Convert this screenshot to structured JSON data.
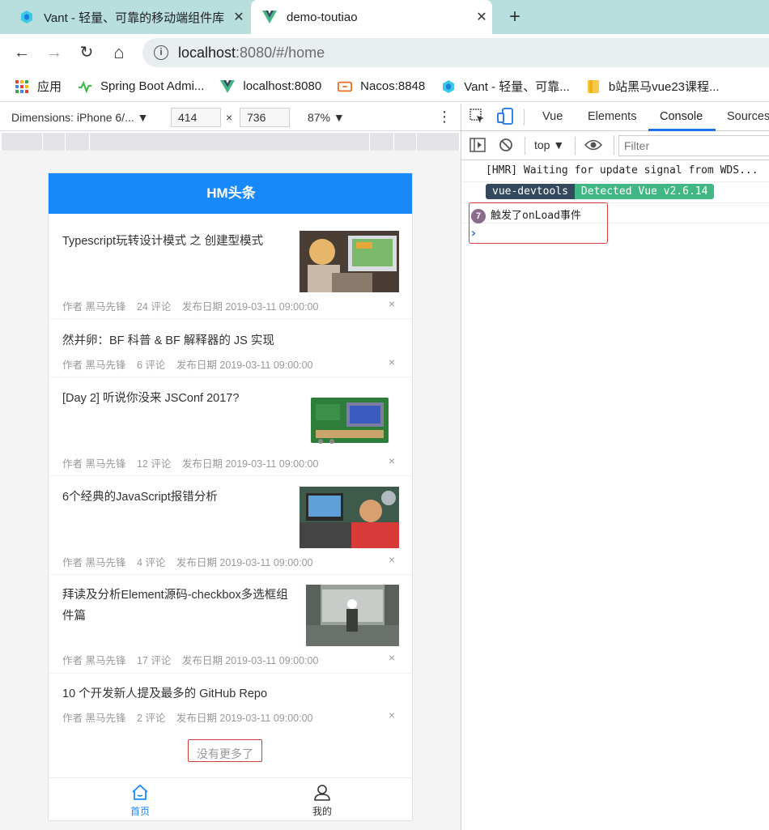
{
  "browser": {
    "tabs": [
      {
        "title": "Vant - 轻量、可靠的移动端组件库",
        "close": "✕",
        "active": false
      },
      {
        "title": "demo-toutiao",
        "close": "✕",
        "active": true
      }
    ],
    "new_tab": "+",
    "nav": {
      "back": "←",
      "forward": "→",
      "reload": "↻",
      "home": "⌂"
    },
    "url_host": "localhost",
    "url_rest": ":8080/#/home",
    "bookmarks": [
      {
        "label": "应用",
        "icon": "apps-grid-icon"
      },
      {
        "label": "Spring Boot Admi...",
        "icon": "spring-boot-icon"
      },
      {
        "label": "localhost:8080",
        "icon": "vue-icon"
      },
      {
        "label": "Nacos:8848",
        "icon": "nacos-icon"
      },
      {
        "label": "Vant - 轻量、可靠...",
        "icon": "vant-icon"
      },
      {
        "label": "b站黑马vue23课程...",
        "icon": "folder-icon"
      }
    ]
  },
  "device_toolbar": {
    "dimensions_label": "Dimensions: iPhone 6/... ▼",
    "width": "414",
    "times": "×",
    "height": "736",
    "zoom": "87% ▼",
    "more": "⋮"
  },
  "app": {
    "navbar_title": "HM头条",
    "articles": [
      {
        "title": "Typescript玩转设计模式 之 创建型模式",
        "author": "作者 黑马先锋",
        "comments": "24 评论",
        "date": "发布日期 2019-03-11 09:00:00",
        "has_image": true
      },
      {
        "title": "然并卵：BF 科普 & BF 解释器的 JS 实现",
        "author": "作者 黑马先锋",
        "comments": "6 评论",
        "date": "发布日期 2019-03-11 09:00:00",
        "has_image": false
      },
      {
        "title": "[Day 2] 听说你没来 JSConf 2017?",
        "author": "作者 黑马先锋",
        "comments": "12 评论",
        "date": "发布日期 2019-03-11 09:00:00",
        "has_image": true
      },
      {
        "title": "6个经典的JavaScript报错分析",
        "author": "作者 黑马先锋",
        "comments": "4 评论",
        "date": "发布日期 2019-03-11 09:00:00",
        "has_image": true
      },
      {
        "title_line1": "拜读及分析Element源码-checkbox多选框组",
        "title_line2": "件篇",
        "author": "作者 黑马先锋",
        "comments": "17 评论",
        "date": "发布日期 2019-03-11 09:00:00",
        "has_image": true
      },
      {
        "title": "10 个开发新人提及最多的 GitHub Repo",
        "author": "作者 黑马先锋",
        "comments": "2 评论",
        "date": "发布日期 2019-03-11 09:00:00",
        "has_image": false
      }
    ],
    "close_glyph": "×",
    "no_more": "没有更多了",
    "tabbar": [
      {
        "label": "首页",
        "icon": "home-icon",
        "active": true
      },
      {
        "label": "我的",
        "icon": "user-icon",
        "active": false
      }
    ],
    "accent_color": "#1989fa"
  },
  "devtools": {
    "tabs": [
      "Vue",
      "Elements",
      "Console",
      "Sources"
    ],
    "active_tab": "Console",
    "context": "top ▼",
    "filter_placeholder": "Filter",
    "console_lines": {
      "hmr": "[HMR] Waiting for update signal from WDS...",
      "devtools_badge": "vue-devtools",
      "detected_badge": "Detected Vue v2.6.14",
      "log_count": "7",
      "log_text": "触发了onLoad事件",
      "prompt": "›"
    }
  }
}
